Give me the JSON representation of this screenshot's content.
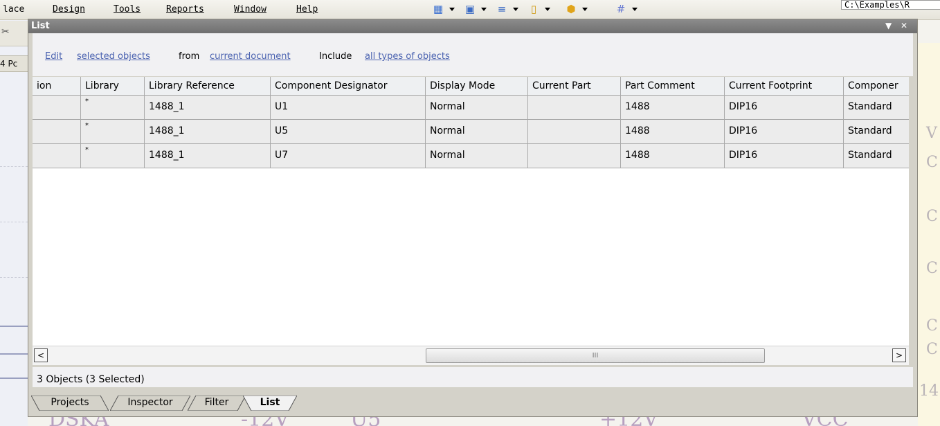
{
  "menubar": {
    "items": [
      "lace",
      "Design",
      "Tools",
      "Reports",
      "Window",
      "Help"
    ],
    "toolbar_icons": [
      "wiring-icon",
      "layout-icon",
      "align-icon",
      "port-icon",
      "shape-icon",
      "grid-icon"
    ],
    "path_value": "C:\\Examples\\R"
  },
  "left_tab_label": "4 Pc",
  "panel": {
    "title": "List",
    "menu_glyph": "▼",
    "close_glyph": "✕",
    "toolbar": {
      "edit_link": "Edit",
      "scope_link": "selected objects",
      "from_text": "from",
      "document_link": "current document",
      "include_text": "Include",
      "types_link": "all types of objects"
    },
    "table": {
      "columns": [
        "ion",
        "Library",
        "Library Reference",
        "Component Designator",
        "Display Mode",
        "Current Part",
        "Part Comment",
        "Current Footprint",
        "Componer"
      ],
      "rows": [
        [
          "",
          "*",
          "1488_1",
          "U1",
          "Normal",
          "",
          "1488",
          "DIP16",
          "Standard"
        ],
        [
          "",
          "*",
          "1488_1",
          "U5",
          "Normal",
          "",
          "1488",
          "DIP16",
          "Standard"
        ],
        [
          "",
          "*",
          "1488_1",
          "U7",
          "Normal",
          "",
          "1488",
          "DIP16",
          "Standard"
        ]
      ]
    },
    "scrollbar": {
      "left_glyph": "<",
      "right_glyph": ">",
      "grip_glyph": "III"
    },
    "status": "3 Objects (3 Selected)",
    "tabs": [
      "Projects",
      "Inspector",
      "Filter",
      "List"
    ],
    "active_tab": "List"
  },
  "right_glyphs": [
    "V",
    "C",
    "C",
    "C",
    "C",
    "C",
    "14"
  ],
  "bottom_fragments": [
    "DSKA",
    "-12V",
    "U5",
    "+12V",
    "VCC"
  ],
  "colors": {
    "link": "#4a62b0",
    "titlebar": "#7a7a7a",
    "panel_frame": "#d4d2c9"
  }
}
